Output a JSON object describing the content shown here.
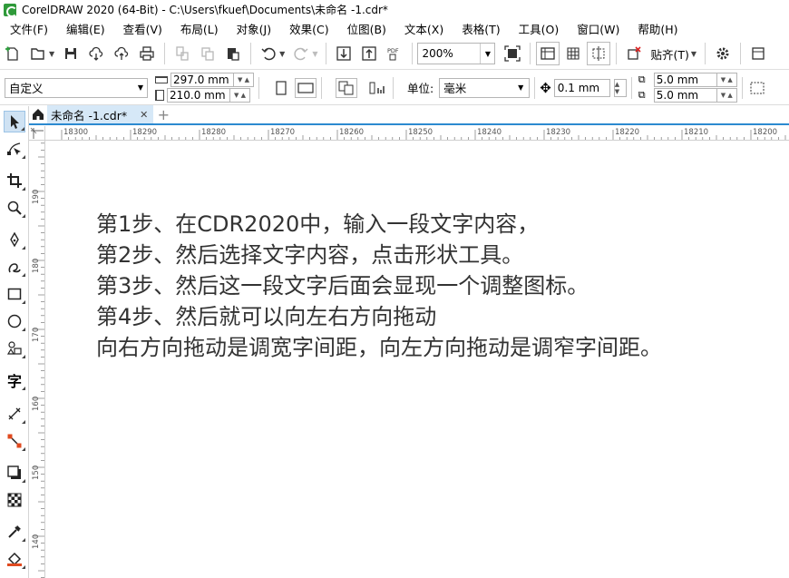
{
  "window": {
    "title": "CorelDRAW 2020 (64-Bit) - C:\\Users\\fkuef\\Documents\\未命名 -1.cdr*"
  },
  "menu": [
    "文件(F)",
    "编辑(E)",
    "查看(V)",
    "布局(L)",
    "对象(J)",
    "效果(C)",
    "位图(B)",
    "文本(X)",
    "表格(T)",
    "工具(O)",
    "窗口(W)",
    "帮助(H)"
  ],
  "toolbar": {
    "zoom": "200%",
    "snap_label": "贴齐(T)",
    "pdf_label": "PDF"
  },
  "property_bar": {
    "preset": "自定义",
    "width": "297.0 mm",
    "height": "210.0 mm",
    "unit_label": "单位:",
    "unit": "毫米",
    "nudge": "0.1 mm",
    "dup_x": "5.0 mm",
    "dup_y": "5.0 mm"
  },
  "tabs": {
    "document": "未命名 -1.cdr*"
  },
  "rulers": {
    "horizontal": [
      "18300",
      "18290",
      "18280",
      "18270",
      "18260",
      "18250",
      "18240",
      "18230",
      "18220",
      "18210",
      "18200"
    ],
    "vertical": [
      "190",
      "180",
      "170",
      "160",
      "150",
      "140"
    ]
  },
  "canvas_text": [
    "第1步、在CDR2020中，输入一段文字内容，",
    "第2步、然后选择文字内容，点击形状工具。",
    "第3步、然后这一段文字后面会显现一个调整图标。",
    "第4步、然后就可以向左右方向拖动",
    "向右方向拖动是调宽字间距，向左方向拖动是调窄字间距。"
  ],
  "toolbox": [
    "pick-tool",
    "shape-tool",
    "crop-tool",
    "zoom-tool",
    "freehand-tool",
    "artistic-media-tool",
    "rectangle-tool",
    "ellipse-tool",
    "polygon-tool",
    "text-tool",
    "parallel-dimension-tool",
    "connector-tool",
    "drop-shadow-tool",
    "transparency-tool",
    "color-eyedropper-tool",
    "interactive-fill-tool"
  ],
  "toolbox_text_glyph": "字"
}
